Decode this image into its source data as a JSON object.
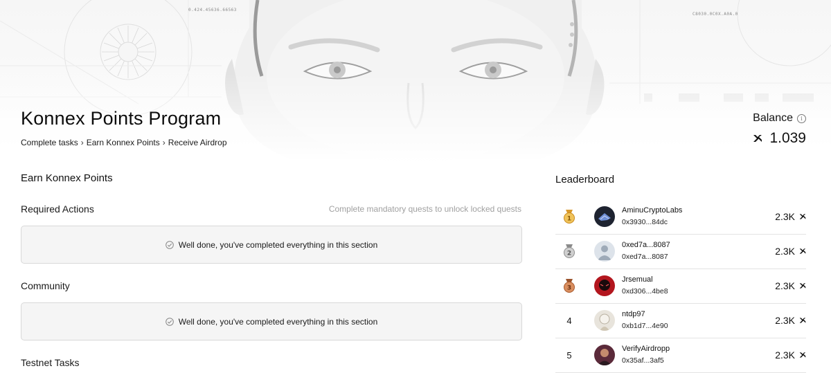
{
  "hero": {
    "coord_left": "0.424.45636.66563",
    "coord_right": "C8030.0C0X.A0A.0"
  },
  "header": {
    "title": "Konnex Points Program",
    "breadcrumb": [
      "Complete tasks",
      "Earn Konnex Points",
      "Receive Airdrop"
    ],
    "breadcrumb_separator": "›",
    "balance_label": "Balance",
    "balance_value": "1.039",
    "info_icon": "info-icon"
  },
  "earn": {
    "heading": "Earn Konnex Points",
    "sections": [
      {
        "title": "Required Actions",
        "hint": "Complete mandatory quests to unlock locked quests",
        "message": "Well done, you've completed everything in this section"
      },
      {
        "title": "Community",
        "message": "Well done, you've completed everything in this section"
      },
      {
        "title": "Testnet Tasks"
      }
    ]
  },
  "leaderboard": {
    "title": "Leaderboard",
    "rows": [
      {
        "rank": "1",
        "badge": "gold-medal-icon",
        "name": "AminuCryptoLabs",
        "address": "0x3930...84dc",
        "points": "2.3K"
      },
      {
        "rank": "2",
        "badge": "silver-medal-icon",
        "name": "0xed7a...8087",
        "address": "0xed7a...8087",
        "points": "2.3K"
      },
      {
        "rank": "3",
        "badge": "bronze-medal-icon",
        "name": "Jrsemual",
        "address": "0xd306...4be8",
        "points": "2.3K"
      },
      {
        "rank": "4",
        "name": "ntdp97",
        "address": "0xb1d7...4e90",
        "points": "2.3K"
      },
      {
        "rank": "5",
        "name": "VerifyAirdropp",
        "address": "0x35af...3af5",
        "points": "2.3K"
      }
    ]
  },
  "colors": {
    "gold": "#e3a73a",
    "silver": "#9a9a9a",
    "bronze": "#b5683c",
    "border": "#d8d8d8",
    "panel": "#f5f5f5",
    "hint": "#a0a0a0"
  }
}
